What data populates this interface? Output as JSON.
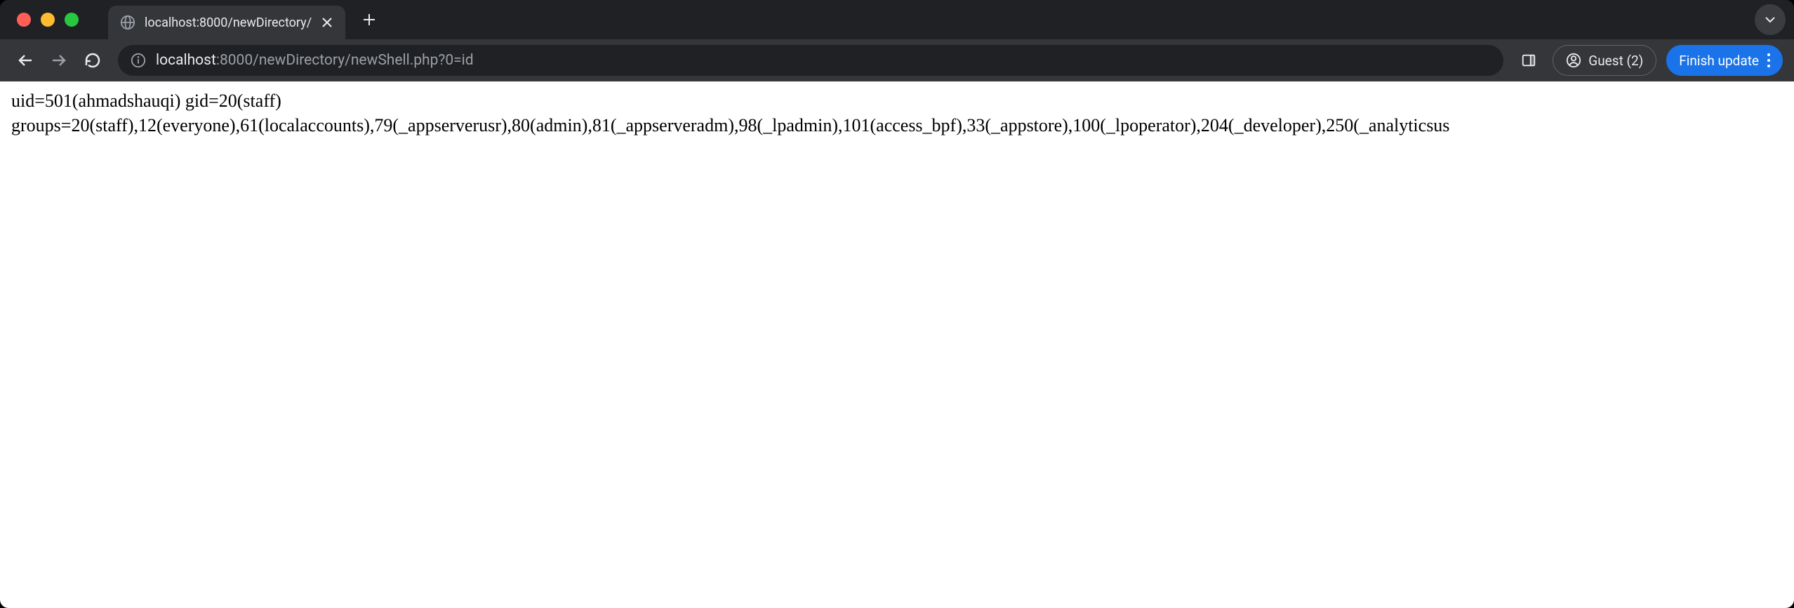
{
  "tab": {
    "title": "localhost:8000/newDirectory/"
  },
  "address_bar": {
    "domain": "localhost",
    "path": ":8000/newDirectory/newShell.php?0=id"
  },
  "profile": {
    "label": "Guest (2)"
  },
  "update_button": {
    "label": "Finish update"
  },
  "page_content": {
    "line1": "uid=501(ahmadshauqi) gid=20(staff)",
    "line2": "groups=20(staff),12(everyone),61(localaccounts),79(_appserverusr),80(admin),81(_appserveradm),98(_lpadmin),101(access_bpf),33(_appstore),100(_lpoperator),204(_developer),250(_analyticsus"
  }
}
